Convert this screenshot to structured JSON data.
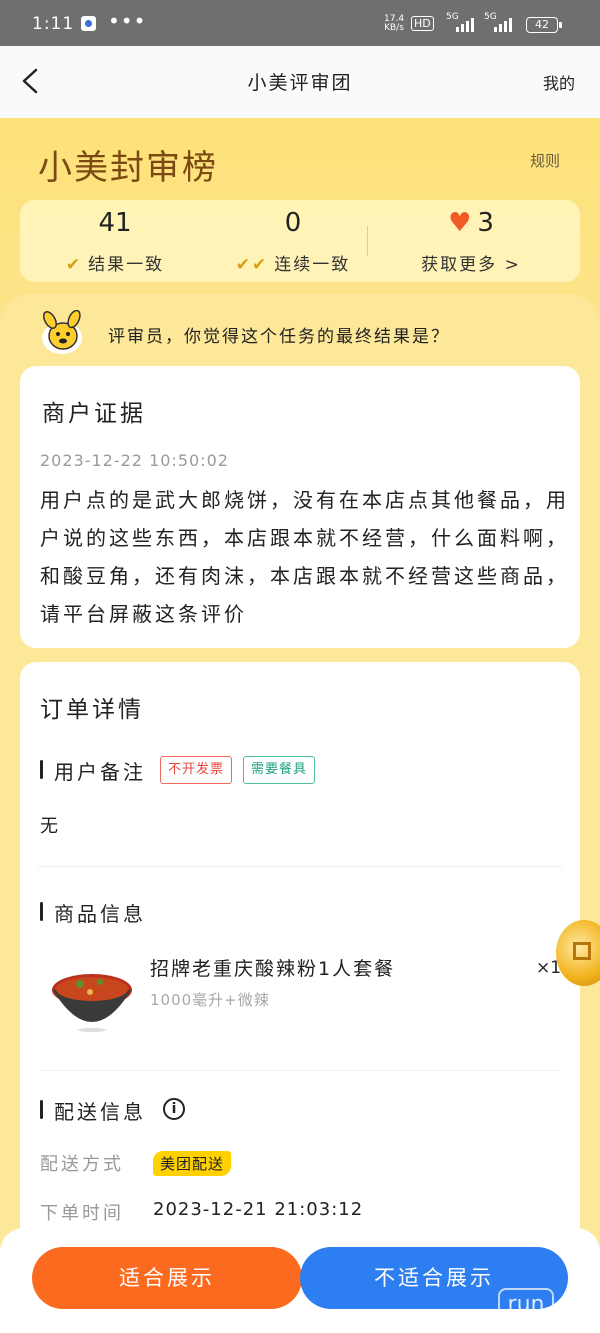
{
  "status_bar": {
    "time": "1:11",
    "dots": "•••",
    "net_speed": "17.4",
    "net_unit": "KB/s",
    "hd": "HD",
    "signal_label": "5G",
    "battery": "42"
  },
  "nav": {
    "title": "小美评审团",
    "right_link": "我的"
  },
  "header": {
    "title": "小美封审榜",
    "rules_link": "规则"
  },
  "stats": {
    "result_consistent": {
      "value": "41",
      "label": "结果一致"
    },
    "streak_consistent": {
      "value": "0",
      "label": "连续一致"
    },
    "hearts": {
      "value": "3",
      "label": "获取更多 >"
    }
  },
  "question": "评审员，你觉得这个任务的最终结果是？",
  "merchant_evidence": {
    "title": "商户证据",
    "timestamp": "2023-12-22 10:50:02",
    "text": "用户点的是武大郎烧饼，没有在本店点其他餐品，用户说的这些东西，本店跟本就不经营，什么面料啊，和酸豆角，还有肉沫，本店跟本就不经营这些商品，请平台屏蔽这条评价"
  },
  "order_details": {
    "title": "订单详情",
    "user_remark": {
      "heading": "用户备注",
      "tags": [
        "不开发票",
        "需要餐具"
      ],
      "value": "无"
    },
    "product_info": {
      "heading": "商品信息",
      "name": "招牌老重庆酸辣粉1人套餐",
      "spec": "1000毫升+微辣",
      "qty": "×1"
    },
    "delivery_info": {
      "heading": "配送信息",
      "method_label": "配送方式",
      "method_value": "美团配送",
      "order_time_label": "下单时间",
      "order_time_value": "2023-12-21 21:03:12"
    }
  },
  "actions": {
    "approve": "适合展示",
    "reject": "不适合展示"
  },
  "watermark": "run",
  "colors": {
    "accent_orange": "#fb6a1f",
    "accent_blue": "#2d7ef0",
    "background_yellow": "#fde799",
    "meituan_yellow": "#ffd100"
  }
}
